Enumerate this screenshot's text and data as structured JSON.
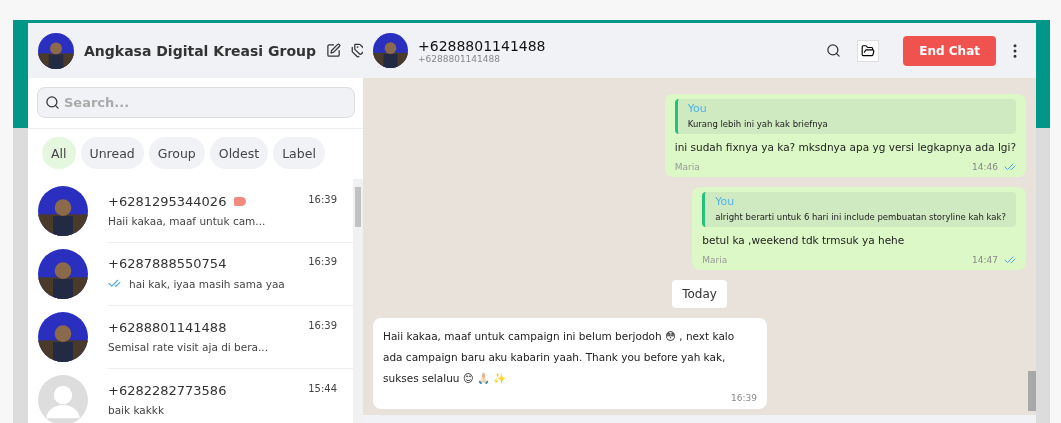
{
  "sidebar": {
    "account": {
      "name": "Angkasa Digital Kreasi Group"
    },
    "search": {
      "placeholder": "Search..."
    },
    "filters": [
      {
        "label": "All",
        "selected": true
      },
      {
        "label": "Unread",
        "selected": false
      },
      {
        "label": "Group",
        "selected": false
      },
      {
        "label": "Oldest",
        "selected": false
      },
      {
        "label": "Label",
        "selected": false
      }
    ],
    "chats": [
      {
        "phone": "+6281295344026",
        "preview": "Haii kakaa, maaf untuk cam...",
        "time": "16:39",
        "color": "#f28b7d",
        "read": false
      },
      {
        "phone": "+6287888550754",
        "preview": "hai kak, iyaa masih sama yaa",
        "time": "16:39",
        "read": true
      },
      {
        "phone": "+6288801141488",
        "preview": "Semisal rate visit aja di bera...",
        "time": "16:39",
        "read": false
      },
      {
        "phone": "+6282282773586",
        "preview": "baik kakkk",
        "time": "15:44",
        "avatar": {
          "kind": "placeholder"
        },
        "read": false
      }
    ]
  },
  "chat": {
    "contact": {
      "name": "+6288801141488",
      "subtitle": "+6288801141488"
    },
    "end_button": "End Chat",
    "messages": [
      {
        "kind": "outgoing",
        "quote": {
          "author": "You",
          "text": "Kurang lebih ini yah kak briefnya"
        },
        "text": "ini sudah fixnya ya ka? mksdnya apa yg versi legkapnya ada lgi?",
        "sender": "Maria",
        "time": "14:46",
        "read": true
      },
      {
        "kind": "outgoing",
        "quote": {
          "author": "You",
          "text": "alright berarti untuk 6 hari ini include pembuatan storyline kah kak?"
        },
        "text": "betul ka ,weekend tdk trmsuk ya hehe",
        "sender": "Maria",
        "time": "14:47",
        "read": true
      },
      {
        "kind": "date",
        "text": "Today"
      },
      {
        "kind": "incoming",
        "text": "Haii kakaa, maaf untuk campaign ini belum berjodoh 😳 , next kalo ada campaign baru aku kabarin yaah. Thank you before yah kak, sukses selaluu 😊 🙏🏻 ✨",
        "time": "16:39"
      }
    ]
  }
}
